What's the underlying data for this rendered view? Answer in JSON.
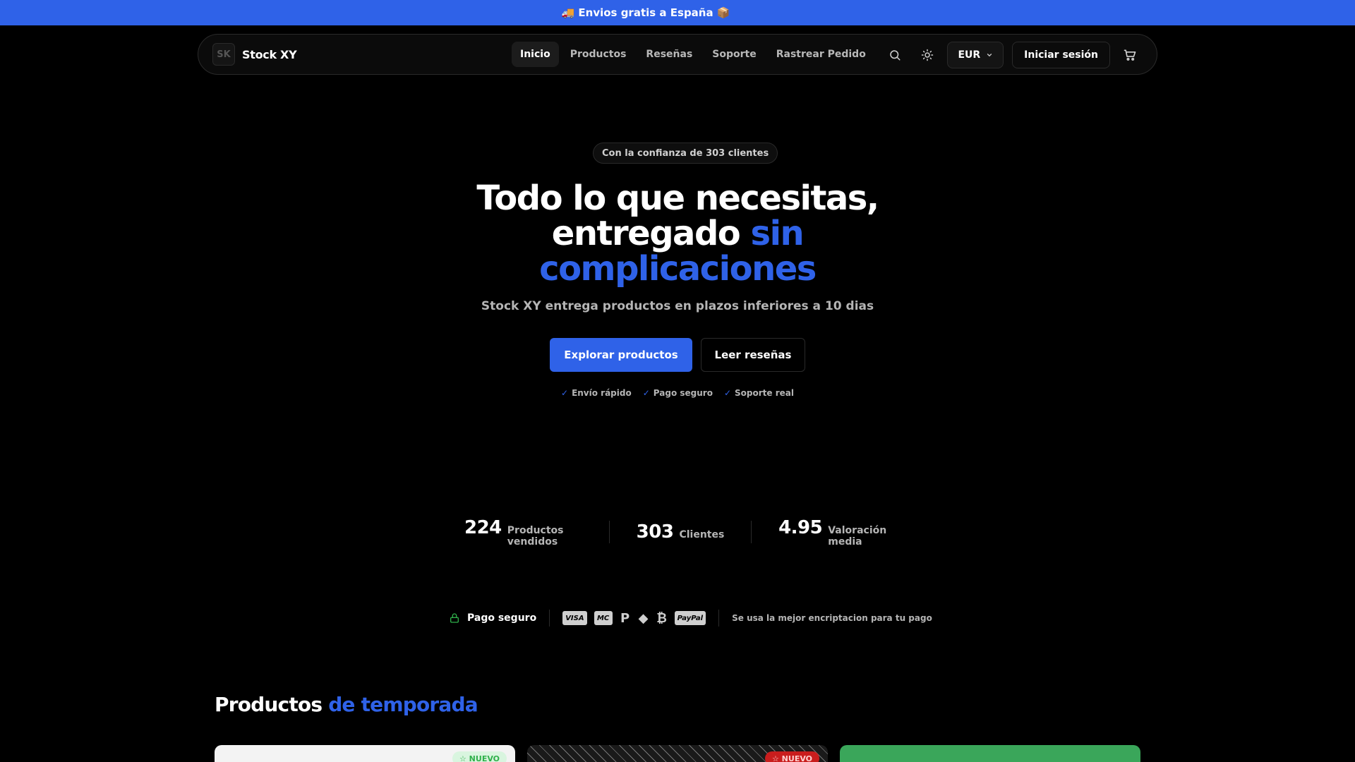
{
  "banner": {
    "text": "🚚 Envios gratis a España 📦"
  },
  "brand": {
    "logo_text": "SK",
    "name": "Stock XY"
  },
  "nav": {
    "links": [
      {
        "label": "Inicio",
        "active": true
      },
      {
        "label": "Productos"
      },
      {
        "label": "Reseñas"
      },
      {
        "label": "Soporte"
      },
      {
        "label": "Rastrear Pedido"
      }
    ],
    "icons": {
      "search": "search-icon",
      "theme": "sun-icon",
      "cart": "cart-icon"
    },
    "currency": "EUR",
    "login_label": "Iniciar sesión"
  },
  "hero": {
    "trust": "Con la confianza de 303 clientes",
    "title_line1": "Todo lo que necesitas,",
    "title_line2": "entregado",
    "title_accent_a": "sin",
    "title_accent_b": "complicaciones",
    "subtitle": "Stock XY entrega productos en plazos inferiores a 10 dias",
    "primary_cta": "Explorar productos",
    "secondary_cta": "Leer reseñas",
    "perks": [
      "Envío rápido",
      "Pago seguro",
      "Soporte real"
    ]
  },
  "stats": [
    {
      "value": "224",
      "label": "Productos vendidos"
    },
    {
      "value": "303",
      "label": "Clientes"
    },
    {
      "value": "4.95",
      "label": "Valoración media"
    }
  ],
  "payment": {
    "secure_label": "Pago seguro",
    "methods": [
      "VISA",
      "MC",
      "P",
      "ETH",
      "₿",
      "PayPal"
    ],
    "note": "Se usa la mejor encriptacion para tu pago"
  },
  "products": {
    "title": "Productos",
    "title_accent": "de temporada",
    "cards": [
      {
        "badge": "☆ NUEVO"
      },
      {
        "badge": "☆ NUEVO"
      },
      {
        "badge": ""
      }
    ]
  },
  "colors": {
    "accent": "#2f62e8",
    "background": "#000000",
    "secure": "#2fb04a"
  }
}
